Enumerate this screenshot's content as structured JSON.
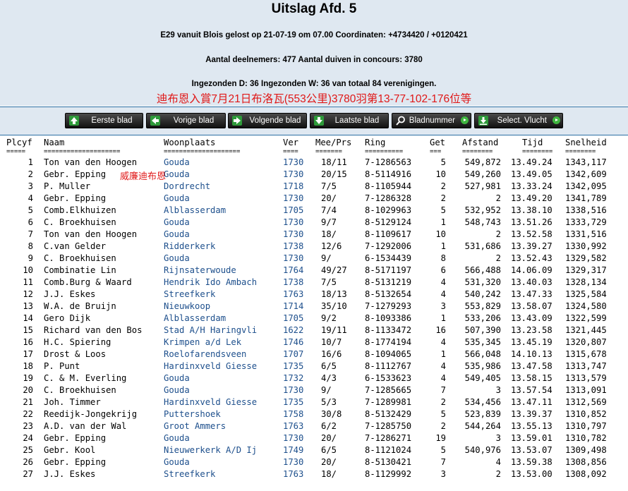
{
  "header": {
    "title": "Uitslag Afd. 5",
    "line1": "E29 vanuit Blois gelost op 21-07-19 om 07.00 Coordinaten: +4734420 / +0120421",
    "line2": "Aantal deelnemers: 477 Aantal duiven in concours: 3780",
    "line3": "Ingezonden D: 36 Ingezonden W: 36 van totaal 84 verenigingen.",
    "chinese_line": "迪布恩入賞7月21日布洛瓦(553公里)3780羽第13-77-102-176位等"
  },
  "nav": {
    "first": "Eerste blad",
    "prev": "Vorige blad",
    "next": "Volgende blad",
    "last": "Laatste blad",
    "page_number": "Bladnummer",
    "select_flight": "Select. Vlucht"
  },
  "columns": {
    "plcyf": "Plcyf",
    "naam": "Naam",
    "woonplaats": "Woonplaats",
    "ver": "Ver",
    "meeprs": "Mee/Prs",
    "ring": "Ring",
    "get": "Get",
    "afstand": "Afstand",
    "tijd": "Tijd",
    "snelheid": "Snelheid"
  },
  "separators": {
    "plcyf": "=====",
    "naam": "====================",
    "woonplaats": "====================",
    "ver": "====",
    "meeprs": "=======",
    "ring": "==========",
    "get": "===",
    "afstand": "========",
    "tijd": "========",
    "snelheid": "========"
  },
  "overlay_text": "威廉迪布恩",
  "rows": [
    {
      "plc": "1",
      "naam": "Ton van den Hoogen",
      "woon": "Gouda",
      "ver": "1730",
      "mee": "18/11",
      "ring": "7-1286563",
      "get": "5",
      "afst": "549,872",
      "tijd": "13.49.24",
      "snel": "1343,117"
    },
    {
      "plc": "2",
      "naam": "Gebr. Epping",
      "woon": "Gouda",
      "ver": "1730",
      "mee": "20/15",
      "ring": "8-5114916",
      "get": "10",
      "afst": "549,260",
      "tijd": "13.49.05",
      "snel": "1342,609"
    },
    {
      "plc": "3",
      "naam": "P. Muller",
      "woon": "Dordrecht",
      "ver": "1718",
      "mee": "7/5",
      "ring": "8-1105944",
      "get": "2",
      "afst": "527,981",
      "tijd": "13.33.24",
      "snel": "1342,095"
    },
    {
      "plc": "4",
      "naam": "Gebr. Epping",
      "woon": "Gouda",
      "ver": "1730",
      "mee": "20/",
      "ring": "7-1286328",
      "get": "2",
      "afst": "2",
      "tijd": "13.49.20",
      "snel": "1341,789"
    },
    {
      "plc": "5",
      "naam": "Comb.Elkhuizen",
      "woon": "Alblasserdam",
      "ver": "1705",
      "mee": "7/4",
      "ring": "8-1029963",
      "get": "5",
      "afst": "532,952",
      "tijd": "13.38.10",
      "snel": "1338,516"
    },
    {
      "plc": "6",
      "naam": "C. Broekhuisen",
      "woon": "Gouda",
      "ver": "1730",
      "mee": "9/7",
      "ring": "8-5129124",
      "get": "1",
      "afst": "548,743",
      "tijd": "13.51.26",
      "snel": "1333,729"
    },
    {
      "plc": "7",
      "naam": "Ton van den Hoogen",
      "woon": "Gouda",
      "ver": "1730",
      "mee": "18/",
      "ring": "8-1109617",
      "get": "10",
      "afst": "2",
      "tijd": "13.52.58",
      "snel": "1331,516"
    },
    {
      "plc": "8",
      "naam": "C.van Gelder",
      "woon": "Ridderkerk",
      "ver": "1738",
      "mee": "12/6",
      "ring": "7-1292006",
      "get": "1",
      "afst": "531,686",
      "tijd": "13.39.27",
      "snel": "1330,992"
    },
    {
      "plc": "9",
      "naam": "C. Broekhuisen",
      "woon": "Gouda",
      "ver": "1730",
      "mee": "9/",
      "ring": "6-1534439",
      "get": "8",
      "afst": "2",
      "tijd": "13.52.43",
      "snel": "1329,582"
    },
    {
      "plc": "10",
      "naam": "Combinatie Lin",
      "woon": "Rijnsaterwoude",
      "ver": "1764",
      "mee": "49/27",
      "ring": "8-5171197",
      "get": "6",
      "afst": "566,488",
      "tijd": "14.06.09",
      "snel": "1329,317"
    },
    {
      "plc": "11",
      "naam": "Comb.Burg & Waard",
      "woon": "Hendrik Ido Ambach",
      "ver": "1738",
      "mee": "7/5",
      "ring": "8-5131219",
      "get": "4",
      "afst": "531,320",
      "tijd": "13.40.03",
      "snel": "1328,134"
    },
    {
      "plc": "12",
      "naam": "J.J. Eskes",
      "woon": "Streefkerk",
      "ver": "1763",
      "mee": "18/13",
      "ring": "8-5132654",
      "get": "4",
      "afst": "540,242",
      "tijd": "13.47.33",
      "snel": "1325,584"
    },
    {
      "plc": "13",
      "naam": "W.A. de Bruijn",
      "woon": "Nieuwkoop",
      "ver": "1714",
      "mee": "35/10",
      "ring": "7-1279293",
      "get": "3",
      "afst": "553,829",
      "tijd": "13.58.07",
      "snel": "1324,580"
    },
    {
      "plc": "14",
      "naam": "Gero Dijk",
      "woon": "Alblasserdam",
      "ver": "1705",
      "mee": "9/2",
      "ring": "8-1093386",
      "get": "1",
      "afst": "533,206",
      "tijd": "13.43.09",
      "snel": "1322,599"
    },
    {
      "plc": "15",
      "naam": "Richard van den Bos",
      "woon": "Stad A/H Haringvli",
      "ver": "1622",
      "mee": "19/11",
      "ring": "8-1133472",
      "get": "16",
      "afst": "507,390",
      "tijd": "13.23.58",
      "snel": "1321,445"
    },
    {
      "plc": "16",
      "naam": "H.C. Spiering",
      "woon": "Krimpen a/d Lek",
      "ver": "1746",
      "mee": "10/7",
      "ring": "8-1774194",
      "get": "4",
      "afst": "535,345",
      "tijd": "13.45.19",
      "snel": "1320,807"
    },
    {
      "plc": "17",
      "naam": "Drost & Loos",
      "woon": "Roelofarendsveen",
      "ver": "1707",
      "mee": "16/6",
      "ring": "8-1094065",
      "get": "1",
      "afst": "566,048",
      "tijd": "14.10.13",
      "snel": "1315,678"
    },
    {
      "plc": "18",
      "naam": "P. Punt",
      "woon": "Hardinxveld Giesse",
      "ver": "1735",
      "mee": "6/5",
      "ring": "8-1112767",
      "get": "4",
      "afst": "535,986",
      "tijd": "13.47.58",
      "snel": "1313,747"
    },
    {
      "plc": "19",
      "naam": "C. & M. Everling",
      "woon": "Gouda",
      "ver": "1732",
      "mee": "4/3",
      "ring": "6-1533623",
      "get": "4",
      "afst": "549,405",
      "tijd": "13.58.15",
      "snel": "1313,579"
    },
    {
      "plc": "20",
      "naam": "C. Broekhuisen",
      "woon": "Gouda",
      "ver": "1730",
      "mee": "9/",
      "ring": "7-1285665",
      "get": "7",
      "afst": "3",
      "tijd": "13.57.54",
      "snel": "1313,091"
    },
    {
      "plc": "21",
      "naam": "Joh. Timmer",
      "woon": "Hardinxveld Giesse",
      "ver": "1735",
      "mee": "5/3",
      "ring": "7-1289981",
      "get": "2",
      "afst": "534,456",
      "tijd": "13.47.11",
      "snel": "1312,569"
    },
    {
      "plc": "22",
      "naam": "Reedijk-Jongekrijg",
      "woon": "Puttershoek",
      "ver": "1758",
      "mee": "30/8",
      "ring": "8-5132429",
      "get": "5",
      "afst": "523,839",
      "tijd": "13.39.37",
      "snel": "1310,852"
    },
    {
      "plc": "23",
      "naam": "A.D. van der Wal",
      "woon": "Groot Ammers",
      "ver": "1763",
      "mee": "6/2",
      "ring": "7-1285750",
      "get": "2",
      "afst": "544,264",
      "tijd": "13.55.13",
      "snel": "1310,797"
    },
    {
      "plc": "24",
      "naam": "Gebr. Epping",
      "woon": "Gouda",
      "ver": "1730",
      "mee": "20/",
      "ring": "7-1286271",
      "get": "19",
      "afst": "3",
      "tijd": "13.59.01",
      "snel": "1310,782"
    },
    {
      "plc": "25",
      "naam": "Gebr. Kool",
      "woon": "Nieuwerkerk A/D Ij",
      "ver": "1749",
      "mee": "6/5",
      "ring": "8-1121024",
      "get": "5",
      "afst": "540,976",
      "tijd": "13.53.07",
      "snel": "1309,498"
    },
    {
      "plc": "26",
      "naam": "Gebr. Epping",
      "woon": "Gouda",
      "ver": "1730",
      "mee": "20/",
      "ring": "8-5130421",
      "get": "7",
      "afst": "4",
      "tijd": "13.59.38",
      "snel": "1308,856"
    },
    {
      "plc": "27",
      "naam": "J.J. Eskes",
      "woon": "Streefkerk",
      "ver": "1763",
      "mee": "18/",
      "ring": "8-1129992",
      "get": "3",
      "afst": "2",
      "tijd": "13.53.00",
      "snel": "1308,092"
    }
  ]
}
